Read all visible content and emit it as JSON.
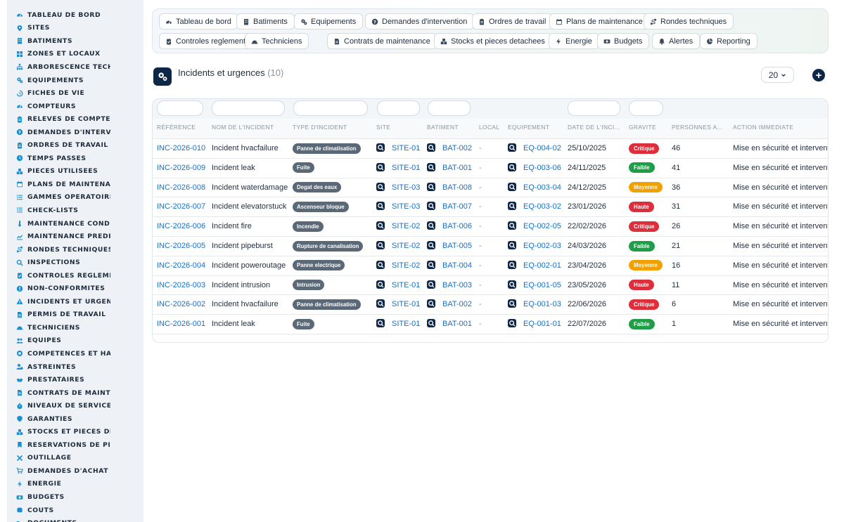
{
  "sidebar": {
    "items": [
      {
        "label": "TABLEAU DE BORD",
        "icon": "gauge-icon"
      },
      {
        "label": "SITES",
        "icon": "map-pin-icon"
      },
      {
        "label": "BATIMENTS",
        "icon": "building-icon"
      },
      {
        "label": "ZONES ET LOCAUX",
        "icon": "grid-icon"
      },
      {
        "label": "ARBORESCENCE TECHNI",
        "icon": "hierarchy-icon"
      },
      {
        "label": "EQUIPEMENTS",
        "icon": "cogs-icon"
      },
      {
        "label": "FICHES DE VIE",
        "icon": "history-icon"
      },
      {
        "label": "COMPTEURS",
        "icon": "gauge-icon"
      },
      {
        "label": "RELEVES DE COMPTEURS",
        "icon": "clipboard-icon"
      },
      {
        "label": "DEMANDES D'INTERVENT",
        "icon": "question-circle-icon"
      },
      {
        "label": "ORDRES DE TRAVAIL",
        "icon": "clipboard-icon"
      },
      {
        "label": "TEMPS PASSES",
        "icon": "clock-icon"
      },
      {
        "label": "PIECES UTILISEES",
        "icon": "boxes-icon"
      },
      {
        "label": "PLANS DE MAINTENANCE",
        "icon": "calendar-icon"
      },
      {
        "label": "GAMMES OPERATOIRES",
        "icon": "list-icon"
      },
      {
        "label": "CHECK-LISTS",
        "icon": "list-icon"
      },
      {
        "label": "MAINTENANCE CONDITIO",
        "icon": "thermometer-icon"
      },
      {
        "label": "MAINTENANCE PREDICTI",
        "icon": "chart-icon"
      },
      {
        "label": "RONDES TECHNIQUES",
        "icon": "route-icon"
      },
      {
        "label": "INSPECTIONS",
        "icon": "search-icon"
      },
      {
        "label": "CONTROLES REGLEMENT",
        "icon": "clipboard-check-icon"
      },
      {
        "label": "NON-CONFORMITES",
        "icon": "alert-circle-icon"
      },
      {
        "label": "INCIDENTS ET URGENCES",
        "icon": "warning-icon"
      },
      {
        "label": "PERMIS DE TRAVAIL",
        "icon": "document-icon"
      },
      {
        "label": "TECHNICIENS",
        "icon": "hard-hat-icon"
      },
      {
        "label": "EQUIPES",
        "icon": "users-icon"
      },
      {
        "label": "COMPETENCES ET HABIL",
        "icon": "certificate-icon"
      },
      {
        "label": "ASTREINTES",
        "icon": "user-clock-icon"
      },
      {
        "label": "PRESTATAIRES",
        "icon": "handshake-icon"
      },
      {
        "label": "CONTRATS DE MAINTENA",
        "icon": "document-icon"
      },
      {
        "label": "NIVEAUX DE SERVICE (SL",
        "icon": "stopwatch-icon"
      },
      {
        "label": "GARANTIES",
        "icon": "shield-icon"
      },
      {
        "label": "STOCKS ET PIECES DETA",
        "icon": "boxes-icon"
      },
      {
        "label": "RESERVATIONS DE PIECE",
        "icon": "bookmark-icon"
      },
      {
        "label": "OUTILLAGE",
        "icon": "tools-icon"
      },
      {
        "label": "DEMANDES D'ACHAT",
        "icon": "cart-icon"
      },
      {
        "label": "ENERGIE",
        "icon": "bolt-icon"
      },
      {
        "label": "BUDGETS",
        "icon": "money-icon"
      },
      {
        "label": "COUTS",
        "icon": "coins-icon"
      },
      {
        "label": "DOCUMENTS",
        "icon": "folder-icon"
      }
    ]
  },
  "topnav": {
    "row1": [
      {
        "label": "Tableau de bord",
        "icon": "gauge-icon"
      },
      {
        "label": "Batiments",
        "icon": "building-icon"
      },
      {
        "label": "Equipements",
        "icon": "cogs-icon"
      },
      {
        "label": "Demandes d'intervention",
        "icon": "question-circle-icon"
      },
      {
        "label": "Ordres de travail",
        "icon": "clipboard-icon"
      },
      {
        "label": "Plans de maintenance",
        "icon": "calendar-icon"
      },
      {
        "label": "Rondes techniques",
        "icon": "route-icon"
      }
    ],
    "row2": [
      {
        "label": "Controles reglementaires",
        "icon": "clipboard-check-icon"
      },
      {
        "label": "Techniciens",
        "icon": "hard-hat-icon"
      },
      {
        "label": "Contrats de maintenance",
        "icon": "document-icon"
      },
      {
        "label": "Stocks et pieces detachees",
        "icon": "boxes-icon"
      },
      {
        "label": "Energie",
        "icon": "bolt-icon"
      },
      {
        "label": "Budgets",
        "icon": "money-icon"
      },
      {
        "label": "Alertes",
        "icon": "bell-icon"
      },
      {
        "label": "Reporting",
        "icon": "pie-chart-icon"
      }
    ]
  },
  "page": {
    "title": "Incidents et urgences",
    "count": "(10)",
    "per_page": "20",
    "add_label": "+"
  },
  "table": {
    "columns": [
      "RÉFÉRENCE",
      "NOM DE L'INCIDENT",
      "TYPE D'INCIDENT",
      "SITE",
      "BATIMENT",
      "LOCAL",
      "EQUIPEMENT",
      "DATE DE L'INCI...",
      "GRAVITE",
      "PERSONNES A...",
      "ACTION IMMEDIATE"
    ],
    "rows": [
      {
        "ref": "INC-2026-010",
        "name": "Incident hvacfailure",
        "type": "Panne de climatisation",
        "site": "SITE-01",
        "bat": "BAT-002",
        "local": "-",
        "eq": "EQ-004-02",
        "date": "25/10/2025",
        "gravite": "Critique",
        "personnes": "46",
        "action": "Mise en sécurité et intervention"
      },
      {
        "ref": "INC-2026-009",
        "name": "Incident leak",
        "type": "Fuite",
        "site": "SITE-01",
        "bat": "BAT-001",
        "local": "-",
        "eq": "EQ-003-06",
        "date": "24/11/2025",
        "gravite": "Faible",
        "personnes": "41",
        "action": "Mise en sécurité et intervention"
      },
      {
        "ref": "INC-2026-008",
        "name": "Incident waterdamage",
        "type": "Degat des eaux",
        "site": "SITE-03",
        "bat": "BAT-008",
        "local": "-",
        "eq": "EQ-003-04",
        "date": "24/12/2025",
        "gravite": "Moyenne",
        "personnes": "36",
        "action": "Mise en sécurité et intervention"
      },
      {
        "ref": "INC-2026-007",
        "name": "Incident elevatorstuck",
        "type": "Ascenseur bloque",
        "site": "SITE-03",
        "bat": "BAT-007",
        "local": "-",
        "eq": "EQ-003-02",
        "date": "23/01/2026",
        "gravite": "Haute",
        "personnes": "31",
        "action": "Mise en sécurité et intervention"
      },
      {
        "ref": "INC-2026-006",
        "name": "Incident fire",
        "type": "Incendie",
        "site": "SITE-02",
        "bat": "BAT-006",
        "local": "-",
        "eq": "EQ-002-05",
        "date": "22/02/2026",
        "gravite": "Critique",
        "personnes": "26",
        "action": "Mise en sécurité et intervention"
      },
      {
        "ref": "INC-2026-005",
        "name": "Incident pipeburst",
        "type": "Rupture de canalisation",
        "site": "SITE-02",
        "bat": "BAT-005",
        "local": "-",
        "eq": "EQ-002-03",
        "date": "24/03/2026",
        "gravite": "Faible",
        "personnes": "21",
        "action": "Mise en sécurité et intervention"
      },
      {
        "ref": "INC-2026-004",
        "name": "Incident poweroutage",
        "type": "Panne electrique",
        "site": "SITE-02",
        "bat": "BAT-004",
        "local": "-",
        "eq": "EQ-002-01",
        "date": "23/04/2026",
        "gravite": "Moyenne",
        "personnes": "16",
        "action": "Mise en sécurité et intervention"
      },
      {
        "ref": "INC-2026-003",
        "name": "Incident intrusion",
        "type": "Intrusion",
        "site": "SITE-01",
        "bat": "BAT-003",
        "local": "-",
        "eq": "EQ-001-05",
        "date": "23/05/2026",
        "gravite": "Haute",
        "personnes": "11",
        "action": "Mise en sécurité et intervention"
      },
      {
        "ref": "INC-2026-002",
        "name": "Incident hvacfailure",
        "type": "Panne de climatisation",
        "site": "SITE-01",
        "bat": "BAT-002",
        "local": "-",
        "eq": "EQ-001-03",
        "date": "22/06/2026",
        "gravite": "Critique",
        "personnes": "6",
        "action": "Mise en sécurité et intervention"
      },
      {
        "ref": "INC-2026-001",
        "name": "Incident leak",
        "type": "Fuite",
        "site": "SITE-01",
        "bat": "BAT-001",
        "local": "-",
        "eq": "EQ-001-01",
        "date": "22/07/2026",
        "gravite": "Faible",
        "personnes": "1",
        "action": "Mise en sécurité et intervention"
      }
    ]
  },
  "colors": {
    "accent": "#1a6fc0",
    "sidebar_icon": "#1a8fd0",
    "navy": "#0f2747",
    "Critique": "#dc2f3b",
    "Haute": "#dc2f3b",
    "Faible": "#1e9e46",
    "Moyenne": "#f0a000",
    "tag": "#5a6878"
  }
}
